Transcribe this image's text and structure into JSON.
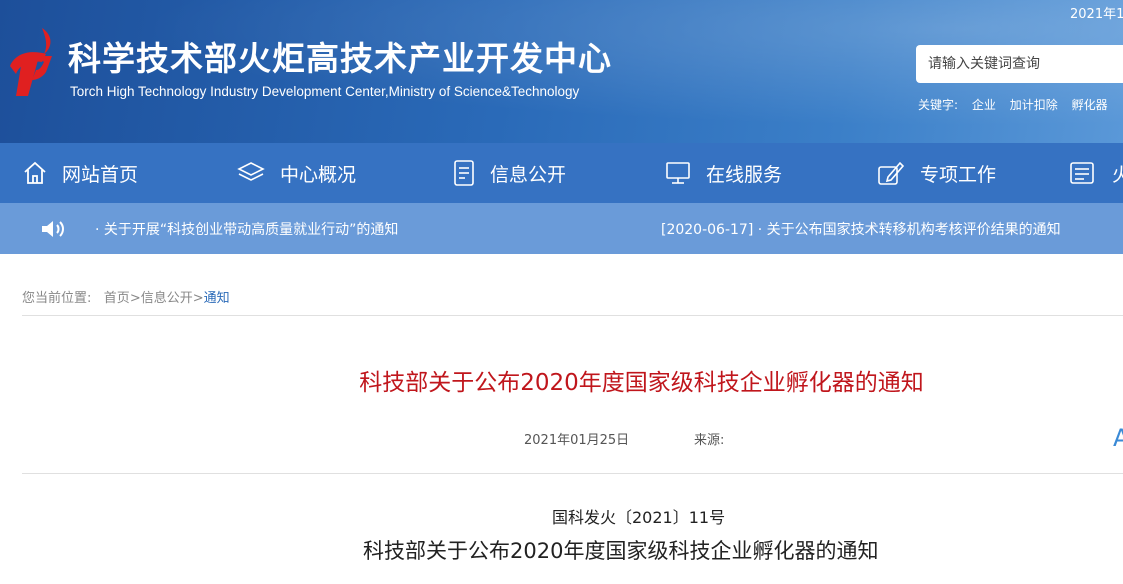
{
  "header": {
    "title": "科学技术部火炬高技术产业开发中心",
    "subtitle": "Torch High Technology Industry Development Center,Ministry of Science&Technology",
    "date": "2021年1",
    "search": {
      "placeholder": "请输入关键词查询"
    },
    "keywords": {
      "label": "关键字:",
      "items": [
        "企业",
        "加计扣除",
        "孵化器"
      ]
    }
  },
  "nav": {
    "items": [
      {
        "label": "网站首页",
        "icon": "home-icon"
      },
      {
        "label": "中心概况",
        "icon": "layers-icon"
      },
      {
        "label": "信息公开",
        "icon": "document-icon"
      },
      {
        "label": "在线服务",
        "icon": "monitor-icon"
      },
      {
        "label": "专项工作",
        "icon": "edit-icon"
      },
      {
        "label": "火炬",
        "icon": "news-icon"
      }
    ]
  },
  "ticker": {
    "icon": "speaker-icon",
    "items": [
      "· 关于开展“科技创业带动高质量就业行动”的通知",
      "[2020-06-17] · 关于公布国家技术转移机构考核评价结果的通知"
    ]
  },
  "breadcrumb": {
    "prefix": "您当前位置:",
    "home": "首页",
    "section": "信息公开",
    "sep": ">",
    "current": "通知"
  },
  "article": {
    "title": "科技部关于公布2020年度国家级科技企业孵化器的通知",
    "date": "2021年01月25日",
    "source_label": "来源:",
    "font_size_glyph": "A",
    "doc_number": "国科发火〔2021〕11号",
    "body_title": "科技部关于公布2020年度国家级科技企业孵化器的通知"
  },
  "colors": {
    "header": "#2a6ab8",
    "nav": "#3672c2",
    "ticker": "#6a9bd9",
    "title_red": "#c0161c",
    "link": "#2a6ab8"
  }
}
